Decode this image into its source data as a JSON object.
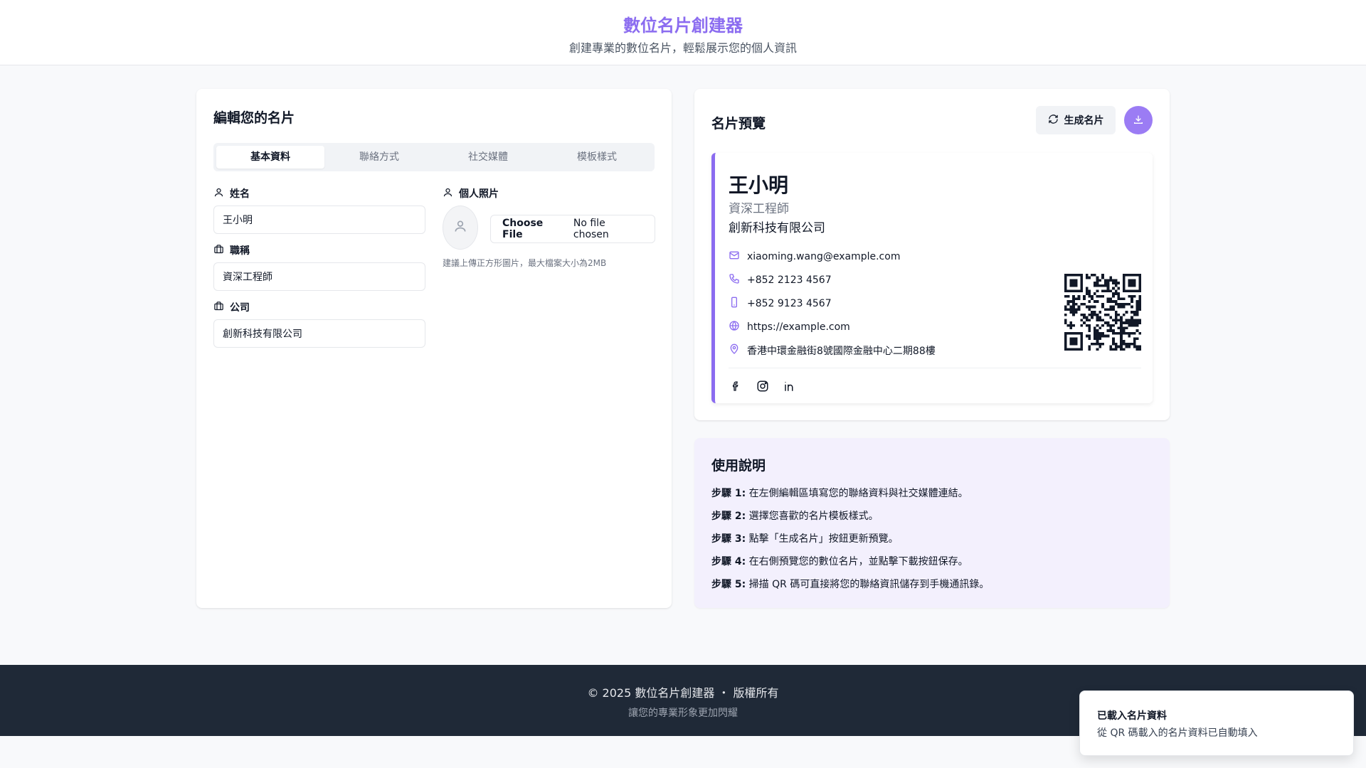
{
  "header": {
    "title": "數位名片創建器",
    "subtitle": "創建專業的數位名片，輕鬆展示您的個人資訊"
  },
  "editor": {
    "heading": "編輯您的名片",
    "tabs": [
      {
        "label": "基本資料",
        "active": true
      },
      {
        "label": "聯絡方式",
        "active": false
      },
      {
        "label": "社交媒體",
        "active": false
      },
      {
        "label": "模板樣式",
        "active": false
      }
    ],
    "fields": {
      "name": {
        "label": "姓名",
        "value": "王小明",
        "icon": "user-icon"
      },
      "job_title": {
        "label": "職稱",
        "value": "資深工程師",
        "icon": "briefcase-icon"
      },
      "company": {
        "label": "公司",
        "value": "創新科技有限公司",
        "icon": "briefcase-icon"
      }
    },
    "photo": {
      "label": "個人照片",
      "choose_label": "Choose File",
      "no_file": "No file chosen",
      "hint": "建議上傳正方形圖片，最大檔案大小為2MB"
    }
  },
  "preview": {
    "heading": "名片預覽",
    "generate_label": "生成名片",
    "card": {
      "name": "王小明",
      "title": "資深工程師",
      "company": "創新科技有限公司",
      "email": "xiaoming.wang@example.com",
      "phone": "+852 2123 4567",
      "mobile": "+852 9123 4567",
      "website": "https://example.com",
      "address": "香港中環金融街8號國際金融中心二期88樓",
      "socials": [
        "facebook-icon",
        "instagram-icon",
        "linkedin-icon"
      ],
      "accent": "#8b6cf0"
    }
  },
  "help": {
    "heading": "使用說明",
    "steps": [
      {
        "label": "步驟 1:",
        "text": "在左側編輯區填寫您的聯絡資料與社交媒體連結。"
      },
      {
        "label": "步驟 2:",
        "text": "選擇您喜歡的名片模板樣式。"
      },
      {
        "label": "步驟 3:",
        "text": "點擊「生成名片」按鈕更新預覽。"
      },
      {
        "label": "步驟 4:",
        "text": "在右側預覽您的數位名片，並點擊下載按鈕保存。"
      },
      {
        "label": "步驟 5:",
        "text": "掃描 QR 碼可直接將您的聯絡資訊儲存到手機通訊錄。"
      }
    ]
  },
  "footer": {
    "copyright": "© 2025 數位名片創建器 ・ 版權所有",
    "tagline": "讓您的專業形象更加閃耀"
  },
  "toast": {
    "title": "已載入名片資料",
    "message": "從 QR 碼載入的名片資料已自動填入"
  },
  "colors": {
    "brand": "#8b6cf0",
    "footer_bg": "#1f2937",
    "help_bg": "#f3f0fd"
  }
}
